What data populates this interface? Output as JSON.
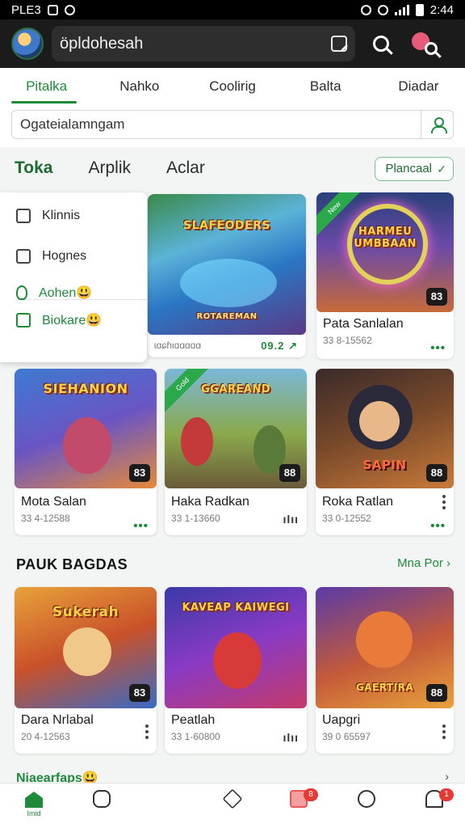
{
  "status_bar": {
    "left_text": "PLE3",
    "time": "2:44"
  },
  "app_bar": {
    "search_value": "öpldohesah"
  },
  "top_tabs": [
    "Pitalka",
    "Nahko",
    "Coolirig",
    "Balta",
    "Diadar"
  ],
  "filter": {
    "placeholder": "Ogateialamngam"
  },
  "sub_tabs": [
    "Toka",
    "Arplik",
    "Aclar"
  ],
  "plan_button": "Plancaal",
  "menu": {
    "items": [
      {
        "label": "Klinnis",
        "icon": "edit-icon"
      },
      {
        "label": "Hognes",
        "icon": "note-icon"
      },
      {
        "label": "Aohen😃",
        "icon": "mic-icon"
      },
      {
        "label": "Biokare😃",
        "icon": "bookmark-icon"
      }
    ]
  },
  "row1": [
    {
      "art_title": "SLAFEODERS",
      "art_subtitle": "ROTAREMAN",
      "badge": "",
      "sub": "ɩɑɕɦιɑɑɑɑɑ",
      "meta": "09.2 ↗",
      "hidden_by_menu": true
    },
    {
      "art_title": "HARMEU UMBBAAN",
      "badge": "83",
      "ribbon": "New",
      "title": "Pata Sanlalan",
      "sub": "33 8-15562"
    }
  ],
  "row2": [
    {
      "art_title": "SIEHANION",
      "badge": "83",
      "title": "Mota Salan",
      "sub": "33 4-12588"
    },
    {
      "art_title": "GGAREAND",
      "badge": "88",
      "ribbon": "Gold",
      "title": "Haka Radkan",
      "sub": "33 1-13660"
    },
    {
      "art_title": "SAPIN",
      "badge": "88",
      "title": "Roka Ratlan",
      "sub": "33 0-12552"
    }
  ],
  "section2": {
    "title": "PAUK BAGDAS",
    "see_more": "Mna Por ›"
  },
  "row3": [
    {
      "art_title": "Sukerah",
      "badge": "83",
      "title": "Dara Nrlabal",
      "sub": "20 4-12563"
    },
    {
      "art_title": "KAVEAP KAIWEGI",
      "badge": "",
      "title": "Peatlah",
      "sub": "33 1-60800"
    },
    {
      "art_title": "GAERTIRA",
      "badge": "88",
      "title": "Uapgri",
      "sub": "39 0 65597"
    }
  ],
  "bottom_section": {
    "title": "Niaearfaps😃"
  },
  "bottom_nav": {
    "home_label": "Imid",
    "notif1": "8",
    "notif2": "1"
  },
  "colors": {
    "accent": "#1f8a3b",
    "appbar": "#1b1b1b"
  }
}
